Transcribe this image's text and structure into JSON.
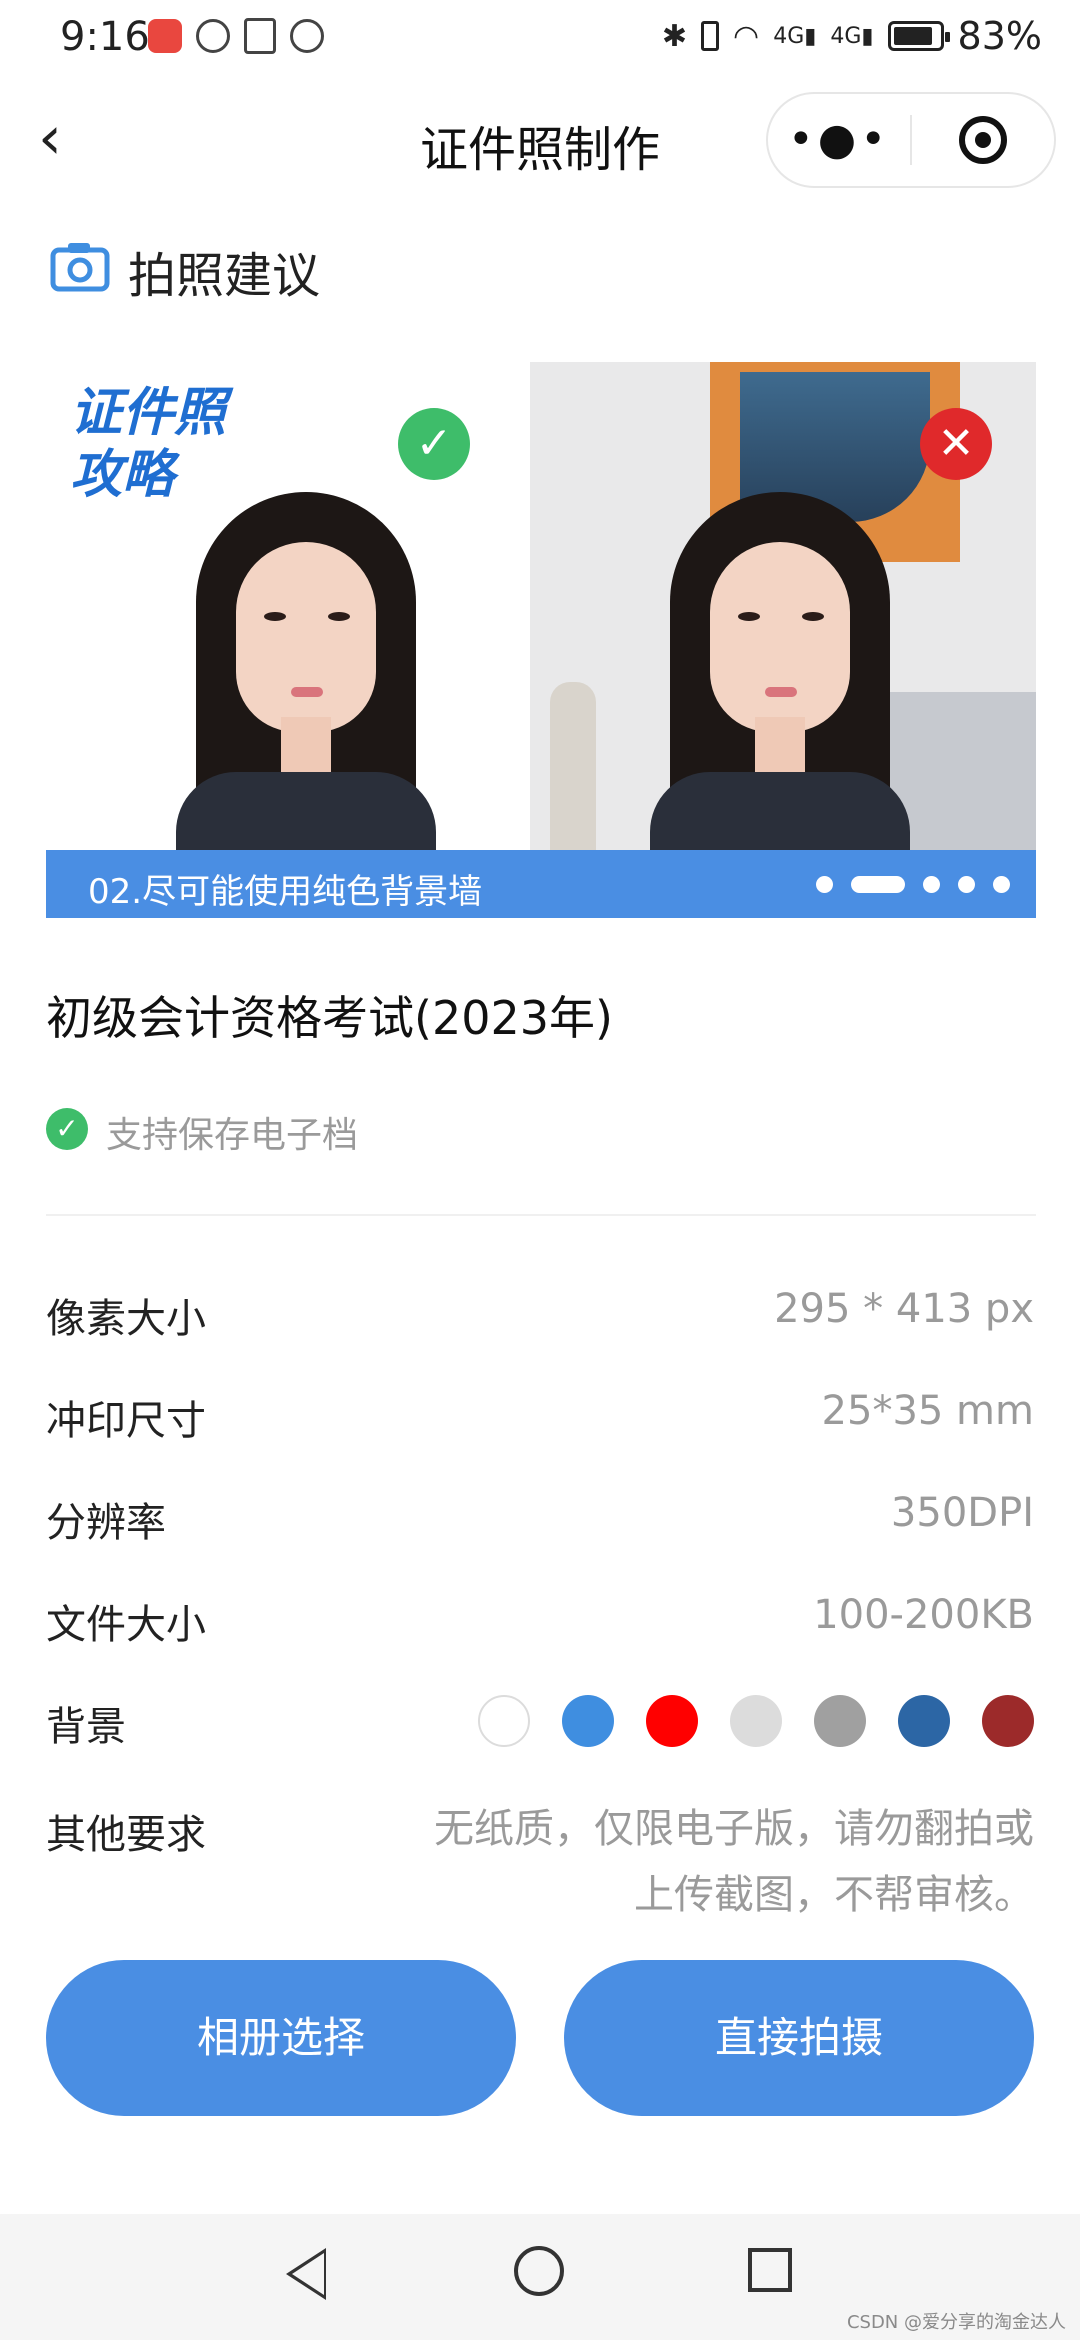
{
  "status": {
    "time": "9:16",
    "battery": "83%",
    "net1": "4G",
    "net2": "4G"
  },
  "header": {
    "back_glyph": "‹",
    "title": "证件照制作",
    "more_glyph": "•●•"
  },
  "suggestion": {
    "title": "拍照建议"
  },
  "banner": {
    "overlay_text_line1": "证件照",
    "overlay_text_line2": "攻略",
    "good_mark": "✓",
    "bad_mark": "✕",
    "caption": "02.尽可能使用纯色背景墙",
    "page_count": 5,
    "active_index": 1
  },
  "exam": {
    "title": "初级会计资格考试(2023年)",
    "save_check": "✓",
    "save_note": "支持保存电子档"
  },
  "specs": {
    "pixel_label": "像素大小",
    "pixel_value": "295 * 413 px",
    "print_label": "冲印尺寸",
    "print_value": "25*35 mm",
    "dpi_label": "分辨率",
    "dpi_value": "350DPI",
    "file_label": "文件大小",
    "file_value": "100-200KB",
    "bg_label": "背景",
    "bg_colors": [
      "#ffffff",
      "#3f8ee0",
      "#ff0000",
      "#dcdcdc",
      "#a0a0a0",
      "#2c66a5",
      "#9c2a2a"
    ],
    "other_label": "其他要求",
    "other_line1": "无纸质，仅限电子版，请勿翻拍或",
    "other_line2": "上传截图，不帮审核。"
  },
  "buttons": {
    "album": "相册选择",
    "camera": "直接拍摄"
  },
  "watermark": "CSDN @爱分享的淘金达人"
}
